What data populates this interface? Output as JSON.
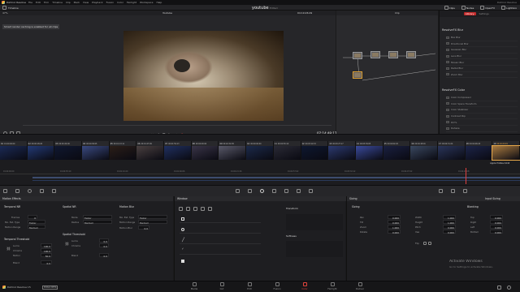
{
  "menu": {
    "app": "DaVinci Resolve",
    "items": [
      "File",
      "Edit",
      "Trim",
      "Timeline",
      "Clip",
      "Mark",
      "View",
      "Playback",
      "Fusion",
      "Color",
      "Fairlight",
      "Workspace",
      "Help"
    ],
    "right_text": "DaVinci Resolve"
  },
  "project_title": "youtube",
  "project_status": "Edited",
  "top_toolbar": {
    "left": [
      "Timeline"
    ],
    "right": [
      "Clips",
      "Nodes",
      "OpenFX",
      "Lightbox"
    ]
  },
  "viewer": {
    "zoom": "47%",
    "timeline_name": "Youtube",
    "timecode_top": "04:19:26:29",
    "clip_label": "Clip",
    "notice": "Smart render caching is enabled for all clips",
    "timecode_bottom": "07:14:48:17"
  },
  "nodes": {
    "node_1": "01",
    "node_2": "02",
    "node_3": "03",
    "node_4": "04",
    "node_5": "05",
    "node_6": "06"
  },
  "fx_library": {
    "tab_active": "Library",
    "tab_other": "Settings",
    "section_blur": "ResolveFX Blur",
    "blur_items": [
      "Box Blur",
      "Directional Blur",
      "Gaussian Blur",
      "Lens Blur",
      "Mosaic Blur",
      "Radial Blur",
      "Zoom Blur"
    ],
    "section_color": "ResolveFX Color",
    "color_items": [
      "Color Compressor",
      "Color Space Transform",
      "Color Stabilizer",
      "Contrast Pop",
      "DCTL",
      "Dehaze"
    ]
  },
  "timeline": {
    "clips": [
      {
        "num": "01",
        "tc": "01:00:00:00",
        "v": "V1"
      },
      {
        "num": "02",
        "tc": "00:00:18:26",
        "v": "V1"
      },
      {
        "num": "03",
        "tc": "00:00:24:00",
        "v": "V1"
      },
      {
        "num": "04",
        "tc": "00:00:36:05",
        "v": "V1"
      },
      {
        "num": "05",
        "tc": "00:01:13:11",
        "v": "V1"
      },
      {
        "num": "06",
        "tc": "00:01:47:09",
        "v": "V1"
      },
      {
        "num": "07",
        "tc": "00:01:59:13",
        "v": "V1"
      },
      {
        "num": "08",
        "tc": "00:00:00:00",
        "v": "V1"
      },
      {
        "num": "09",
        "tc": "00:02:32:05",
        "v": "V1"
      },
      {
        "num": "10",
        "tc": "00:00:00:00",
        "v": "V1"
      },
      {
        "num": "11",
        "tc": "00:02:59:10",
        "v": "V1"
      },
      {
        "num": "12",
        "tc": "00:03:12:15",
        "v": "V1"
      },
      {
        "num": "13",
        "tc": "00:03:27:17",
        "v": "V1"
      },
      {
        "num": "14",
        "tc": "00:03:39:05",
        "v": "V1"
      },
      {
        "num": "15",
        "tc": "00:04:02:20",
        "v": "V1"
      },
      {
        "num": "16",
        "tc": "00:04:18:16",
        "v": "V1"
      },
      {
        "num": "17",
        "tc": "00:04:31:24",
        "v": "V1"
      },
      {
        "num": "18",
        "tc": "00:04:46:18",
        "v": "V1"
      },
      {
        "num": "19",
        "tc": "04:19:22:29",
        "v": "V1"
      }
    ],
    "last_clip_label": "Apple ProRes 4444",
    "ruler": [
      "01:00:00:00",
      "01:00:35:10",
      "01:01:10:20",
      "01:01:46:06",
      "01:02:21:16",
      "01:02:57:02",
      "01:03:32:12",
      "01:04:07:22",
      "01:04:43:08"
    ]
  },
  "motion_effects": {
    "title": "Motion Effects",
    "temporal_nr": "Temporal NR",
    "frames_label": "Frames",
    "frames_value": "0",
    "mo_est_label": "Mo. Est. Type",
    "mo_est_value": "Faster",
    "motion_range_label": "Motion Range",
    "motion_range_value": "Medium",
    "temporal_threshold": "Temporal Threshold",
    "luma_label": "Luma",
    "luma_value": "100.0",
    "chroma_label": "Chroma",
    "chroma_value": "100.0",
    "motion_label": "Motion",
    "motion_value": "50.0",
    "blend_label": "Blend",
    "blend_value": "0.0",
    "spatial_nr": "Spatial NR",
    "mode_label": "Mode",
    "mode_value": "Faster",
    "radius_label": "Radius",
    "radius_value": "Medium",
    "spatial_threshold": "Spatial Threshold",
    "s_luma_value": "0.0",
    "s_chroma_value": "0.0",
    "s_blend_value": "0.0",
    "motion_blur": "Motion Blur",
    "mb_mo_est_value": "Faster",
    "mb_motion_range_label": "Motion Range",
    "mb_motion_range_value": "Medium",
    "mb_motion_blur_label": "Motion Blur",
    "mb_motion_blur_value": "0.0"
  },
  "window_panel": {
    "title": "Window",
    "transform": "Transform",
    "softness": "Softness"
  },
  "sizing_panel": {
    "title": "Sizing",
    "mode": "Input Sizing",
    "sizing_section": "Sizing",
    "pan_label": "Pan",
    "pan_value": "0.000",
    "tilt_label": "Tilt",
    "tilt_value": "0.000",
    "zoom_label": "Zoom",
    "zoom_value": "1.000",
    "rotate_label": "Rotate",
    "rotate_value": "0.000",
    "width_label": "Width",
    "width_value": "1.000",
    "height_label": "Height",
    "height_value": "1.000",
    "pitch_label": "Pitch",
    "pitch_value": "0.000",
    "yaw_label": "Yaw",
    "yaw_value": "0.000",
    "flip_label": "Flip",
    "blanking": "Blanking",
    "top_label": "Top",
    "top_value": "0.000",
    "right_label": "Right",
    "right_value": "0.000",
    "left_label": "Left",
    "left_value": "0.000",
    "bottom_label": "Bottom",
    "bottom_value": "0.000"
  },
  "watermark": {
    "line1": "Activate Windows",
    "line2": "Go to Settings to activate Windows."
  },
  "bottom_bar": {
    "app": "DaVinci Resolve 15",
    "badge": "PUBLIC BETA",
    "pages": [
      "Media",
      "Cut",
      "Edit",
      "Fusion",
      "Color",
      "Fairlight",
      "Deliver"
    ],
    "active_page": "Color"
  }
}
